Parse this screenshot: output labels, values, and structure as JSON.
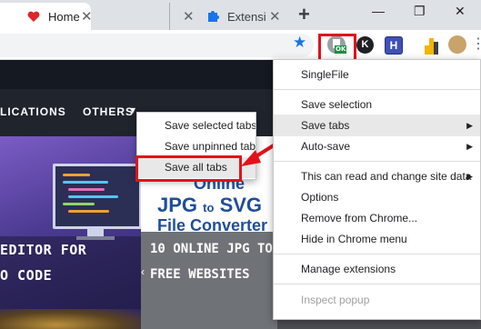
{
  "browser": {
    "tabs": [
      {
        "title": "Home",
        "favicon": "heart-icon",
        "active": true
      },
      {
        "title": "Extensi",
        "favicon": "puzzle-icon",
        "active": false
      }
    ],
    "window_controls": [
      "minimize",
      "restore",
      "close"
    ],
    "toolbar_extensions": [
      "singlefile-icon",
      "k-extension-icon",
      "h-extension-icon",
      "chart-extension-icon"
    ],
    "singlefile_badge": "OK"
  },
  "page": {
    "nav": {
      "applications_label": "LICATIONS",
      "others_label": "OTHERS"
    },
    "card1": {
      "title_line1": "EDITOR FOR",
      "title_line2": "O CODE"
    },
    "card2": {
      "banner_online": "Online",
      "banner_jpg": "JPG",
      "banner_to": "to",
      "banner_svg": "SVG",
      "banner_converter": "File Converter",
      "title_line1": "10 ONLINE JPG TO S",
      "title_line2": "FREE WEBSITES"
    }
  },
  "menu": {
    "items": [
      {
        "label": "SingleFile"
      },
      {
        "label": "Save selection"
      },
      {
        "label": "Save tabs",
        "has_submenu": true,
        "highlighted": true
      },
      {
        "label": "Auto-save",
        "has_submenu": true
      },
      {
        "label": "This can read and change site data",
        "has_submenu": true
      },
      {
        "label": "Options"
      },
      {
        "label": "Remove from Chrome..."
      },
      {
        "label": "Hide in Chrome menu"
      },
      {
        "label": "Manage extensions"
      },
      {
        "label": "Inspect popup",
        "disabled": true
      }
    ]
  },
  "submenu": {
    "items": [
      {
        "label": "Save selected tabs"
      },
      {
        "label": "Save unpinned tabs"
      },
      {
        "label": "Save all tabs",
        "highlighted": true
      }
    ]
  },
  "colors": {
    "highlight_box": "#e3111a",
    "tab_strip": "#dee1e6",
    "menu_hover": "#e8e8e8",
    "bookmark_star": "#1a73e8",
    "card1_bg": "#4b3a91",
    "banner_text": "#1f4e9a"
  }
}
